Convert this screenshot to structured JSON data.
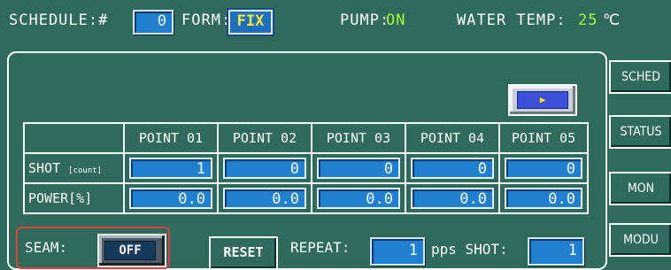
{
  "header": {
    "schedule_label": "SCHEDULE:#",
    "schedule_value": "0",
    "form_label": "FORM:",
    "form_value": "FIX",
    "pump_label": "PUMP:",
    "pump_value": "ON",
    "water_temp_label": "WATER TEMP:",
    "water_temp_value": "25",
    "water_temp_unit": "℃"
  },
  "side_nav": [
    "SCHED",
    "STATUS",
    "MON",
    "MODU"
  ],
  "play_button_glyph": "▶",
  "table": {
    "columns": [
      "POINT 01",
      "POINT 02",
      "POINT 03",
      "POINT 04",
      "POINT 05"
    ],
    "rows": [
      {
        "label": "SHOT",
        "unit": "[count]",
        "values": [
          "1",
          "0",
          "0",
          "0",
          "0"
        ]
      },
      {
        "label": "POWER",
        "unit": "[%]",
        "values": [
          "0.0",
          "0.0",
          "0.0",
          "0.0",
          "0.0"
        ]
      }
    ]
  },
  "bottom": {
    "seam_label": "SEAM:",
    "seam_value": "OFF",
    "reset_label": "RESET",
    "repeat_label": "REPEAT:",
    "repeat_value": "1",
    "pps_shot_label": "pps SHOT:",
    "pps_shot_value": "1"
  },
  "colors": {
    "background": "#2f6b5c",
    "field_blue": "#1f7fd0",
    "status_on": "#a8ff3a",
    "form_value": "#ffea2a",
    "highlight_frame": "#e0403a"
  }
}
